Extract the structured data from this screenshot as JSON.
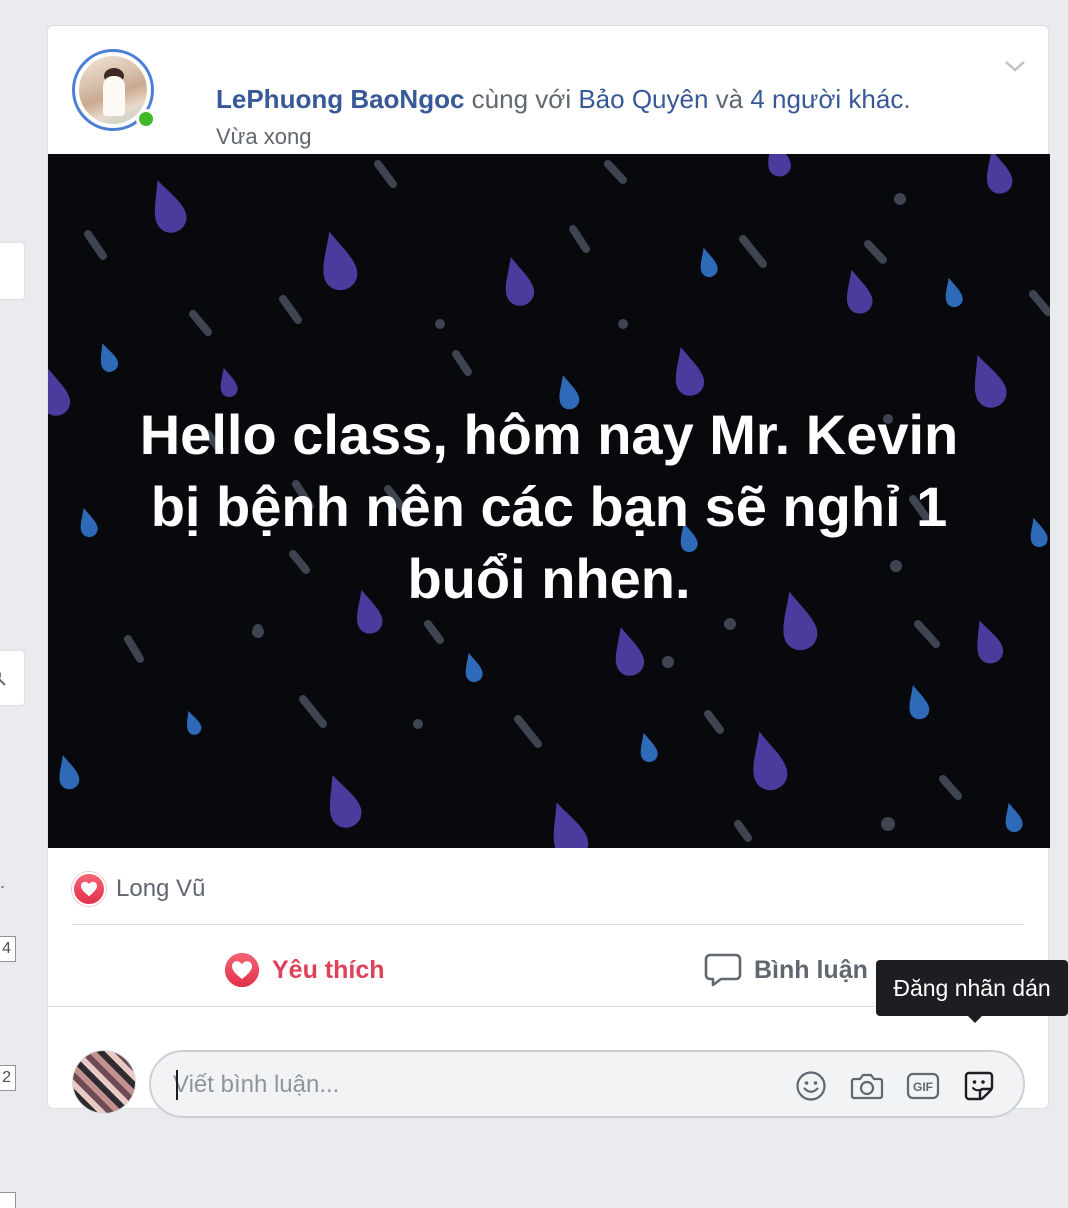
{
  "post": {
    "author": "LePhuong BaoNgoc",
    "with_text": "cùng với",
    "tagged_person": "Bảo Quyên",
    "and_text": "và",
    "others_link": "4 người khác",
    "period": ".",
    "time": "Vừa xong",
    "status_text": "Hello class, hôm nay Mr. Kevin bị bệnh nên các bạn sẽ nghỉ 1 buổi nhen.",
    "background_color": "#07090d"
  },
  "reactions": {
    "type": "heart",
    "names": "Long Vũ",
    "color": "#e0405a"
  },
  "actions": {
    "like_label": "Yêu thích",
    "comment_label": "Bình luận"
  },
  "tooltip": {
    "text": "Đăng nhãn dán"
  },
  "comment_box": {
    "placeholder": "Viết bình luận...",
    "icons": [
      "emoji-icon",
      "camera-icon",
      "gif-icon",
      "sticker-icon"
    ]
  },
  "left_edge": {
    "dot": ".",
    "badge_1": "4",
    "badge_2": "2"
  }
}
